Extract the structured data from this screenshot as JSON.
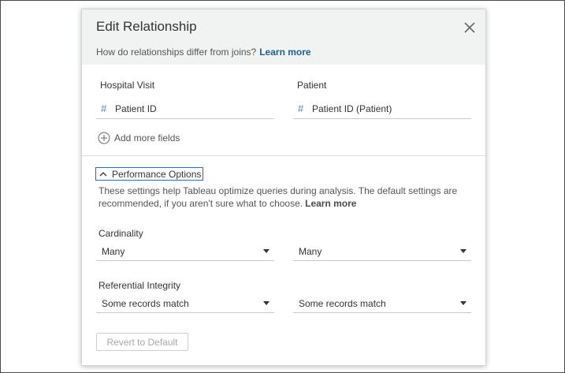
{
  "dialog": {
    "title": "Edit Relationship",
    "subtitle": "How do relationships differ from joins?",
    "learn_more": "Learn more",
    "close_icon": "close-icon"
  },
  "fields": {
    "left_table": "Hospital Visit",
    "right_table": "Patient",
    "left_field": "Patient ID",
    "right_field": "Patient ID (Patient)",
    "field_type_icon": "number-hash-icon",
    "add_more": "Add more fields"
  },
  "performance": {
    "toggle_label": "Performance Options",
    "expanded": true,
    "description": "These settings help Tableau optimize queries during analysis. The default settings are recommended, if you aren't sure what to choose.",
    "learn_more": "Learn more",
    "cardinality_label": "Cardinality",
    "cardinality_left": "Many",
    "cardinality_right": "Many",
    "integrity_label": "Referential Integrity",
    "integrity_left": "Some records match",
    "integrity_right": "Some records match",
    "revert_label": "Revert to Default"
  },
  "colors": {
    "header_bg": "#f1f2f2",
    "link": "#1f5f8b",
    "hash_icon": "#4d8a9a",
    "focus_border": "#2e6da4"
  }
}
